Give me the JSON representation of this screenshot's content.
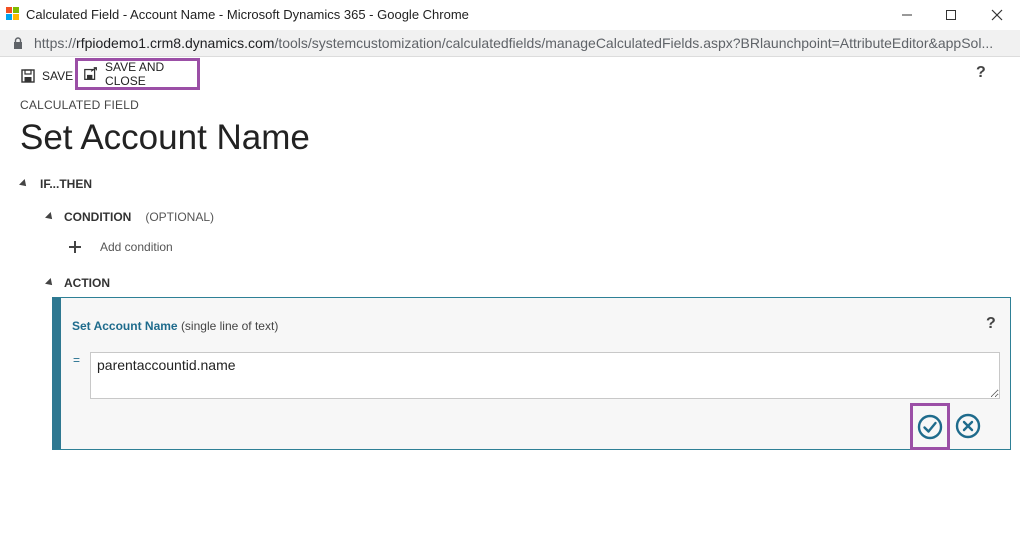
{
  "window": {
    "title": "Calculated Field - Account Name - Microsoft Dynamics 365 - Google Chrome",
    "controls": [
      "minimize",
      "maximize",
      "close"
    ]
  },
  "address_bar": {
    "url_prefix": "https://",
    "url_domain": "rfpiodemo1.crm8.dynamics.com",
    "url_path": "/tools/systemcustomization/calculatedfields/manageCalculatedFields.aspx?BRlaunchpoint=AttributeEditor&appSol..."
  },
  "toolbar": {
    "save_label": "SAVE",
    "save_close_label": "SAVE AND CLOSE",
    "help": "?"
  },
  "header": {
    "section_label": "CALCULATED FIELD",
    "title": "Set Account Name"
  },
  "rules": {
    "ifthen_label": "IF...THEN",
    "condition_label": "CONDITION",
    "condition_optional": "(OPTIONAL)",
    "add_condition_label": "Add condition",
    "action_label": "ACTION"
  },
  "action": {
    "field_name": "Set Account Name",
    "field_type": "(single line of text)",
    "help": "?",
    "operator": "=",
    "expression": "parentaccountid.name"
  },
  "colors": {
    "highlight": "#9b4fa6",
    "accent": "#2e7891"
  }
}
